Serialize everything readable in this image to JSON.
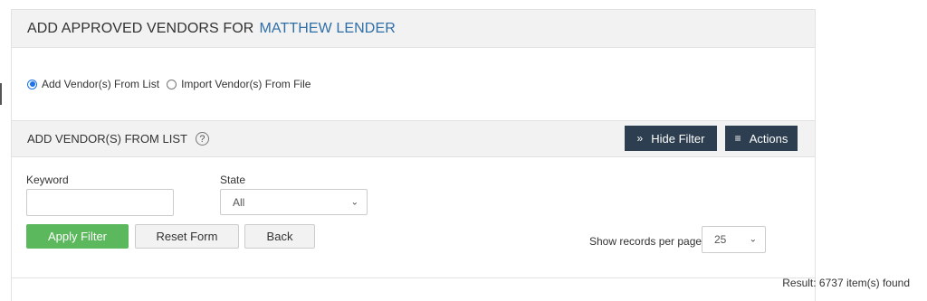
{
  "header": {
    "title_prefix": "ADD APPROVED VENDORS FOR",
    "title_name": "MATTHEW LENDER"
  },
  "mode": {
    "options": [
      {
        "label": "Add Vendor(s) From List",
        "selected": true
      },
      {
        "label": "Import Vendor(s) From File",
        "selected": false
      }
    ]
  },
  "section": {
    "title": "ADD VENDOR(S) FROM LIST",
    "help_glyph": "?",
    "hide_filter_label": "Hide Filter",
    "actions_label": "Actions"
  },
  "filter": {
    "keyword_label": "Keyword",
    "keyword_value": "",
    "state_label": "State",
    "state_value": "All",
    "apply_label": "Apply Filter",
    "reset_label": "Reset Form",
    "back_label": "Back"
  },
  "paging": {
    "show_records_label": "Show records per page",
    "per_page_value": "25"
  },
  "result": {
    "text": "Result: 6737 item(s) found"
  },
  "colors": {
    "accent_link": "#2f6fa8",
    "dark_button": "#2c3e50",
    "apply_green": "#5cb85c",
    "header_bg": "#f2f2f2"
  }
}
